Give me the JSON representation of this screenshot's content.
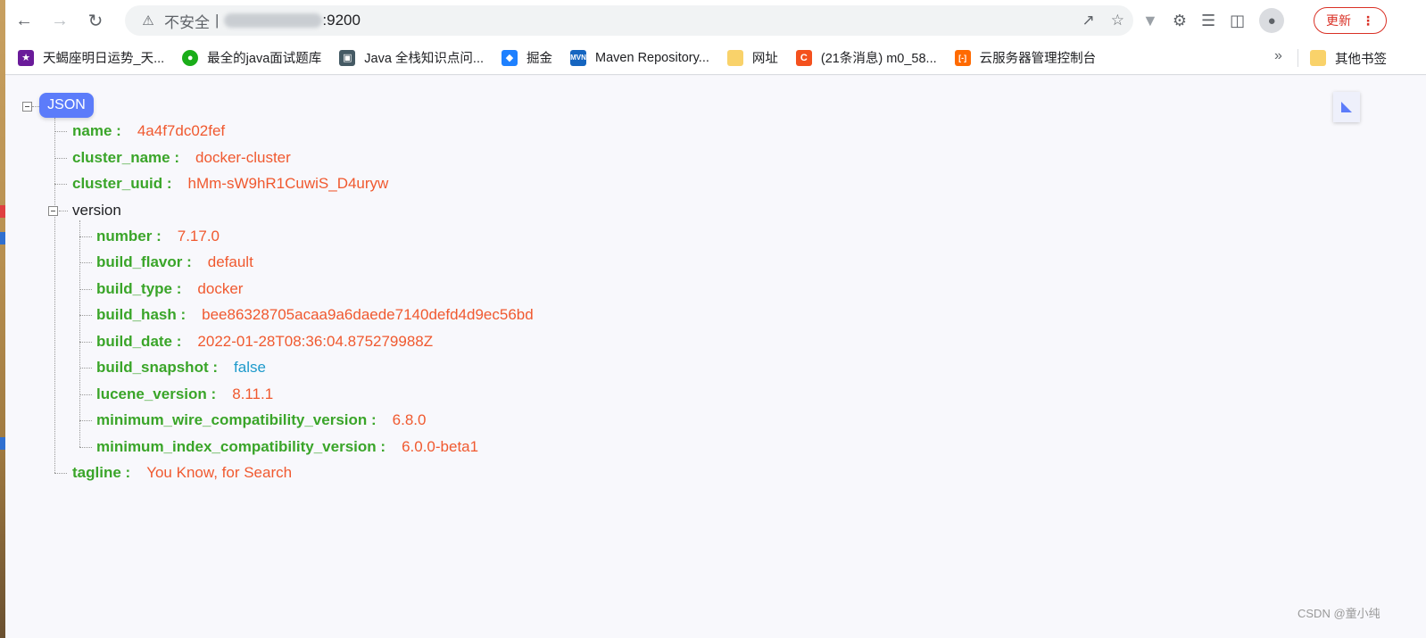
{
  "browser": {
    "omnibox": {
      "insecure_label": "不安全",
      "separator": "|",
      "port": ":9200"
    },
    "update_label": "更新"
  },
  "bookmarks": [
    {
      "label": "天蝎座明日运势_天...",
      "color": "#6a1b9a"
    },
    {
      "label": "最全的java面试题库",
      "color": "#1aad19"
    },
    {
      "label": "Java 全栈知识点问...",
      "color": "#455a64"
    },
    {
      "label": "掘金",
      "color": "#1e80ff"
    },
    {
      "label": "Maven Repository...",
      "color": "#1565c0",
      "glyph": "MVN"
    },
    {
      "label": "网址",
      "color": "#f9d26a"
    },
    {
      "label": "(21条消息) m0_58...",
      "color": "#f4511e",
      "glyph": "C"
    },
    {
      "label": "云服务器管理控制台",
      "color": "#ff6a00",
      "glyph": "[-]"
    }
  ],
  "bookmarks_more": "»",
  "bookmarks_other": "其他书签",
  "json_view": {
    "root_label": "JSON",
    "rows": [
      {
        "key": "name",
        "value": "4a4f7dc02fef"
      },
      {
        "key": "cluster_name",
        "value": "docker-cluster"
      },
      {
        "key": "cluster_uuid",
        "value": "hMm-sW9hR1CuwiS_D4uryw"
      },
      {
        "key": "version"
      },
      {
        "key": "number",
        "value": "7.17.0"
      },
      {
        "key": "build_flavor",
        "value": "default"
      },
      {
        "key": "build_type",
        "value": "docker"
      },
      {
        "key": "build_hash",
        "value": "bee86328705acaa9a6daede7140defd4d9ec56bd"
      },
      {
        "key": "build_date",
        "value": "2022-01-28T08:36:04.875279988Z"
      },
      {
        "key": "build_snapshot",
        "value": "false"
      },
      {
        "key": "lucene_version",
        "value": "8.11.1"
      },
      {
        "key": "minimum_wire_compatibility_version",
        "value": "6.8.0"
      },
      {
        "key": "minimum_index_compatibility_version",
        "value": "6.0.0-beta1"
      },
      {
        "key": "tagline",
        "value": "You Know, for Search"
      }
    ],
    "colon": ":"
  },
  "watermark": "CSDN @童小纯",
  "colors": {
    "key": "#3aa529",
    "string": "#f0592f",
    "bool": "#1e9acb",
    "badge": "#5c7cfa",
    "update": "#d93025"
  }
}
